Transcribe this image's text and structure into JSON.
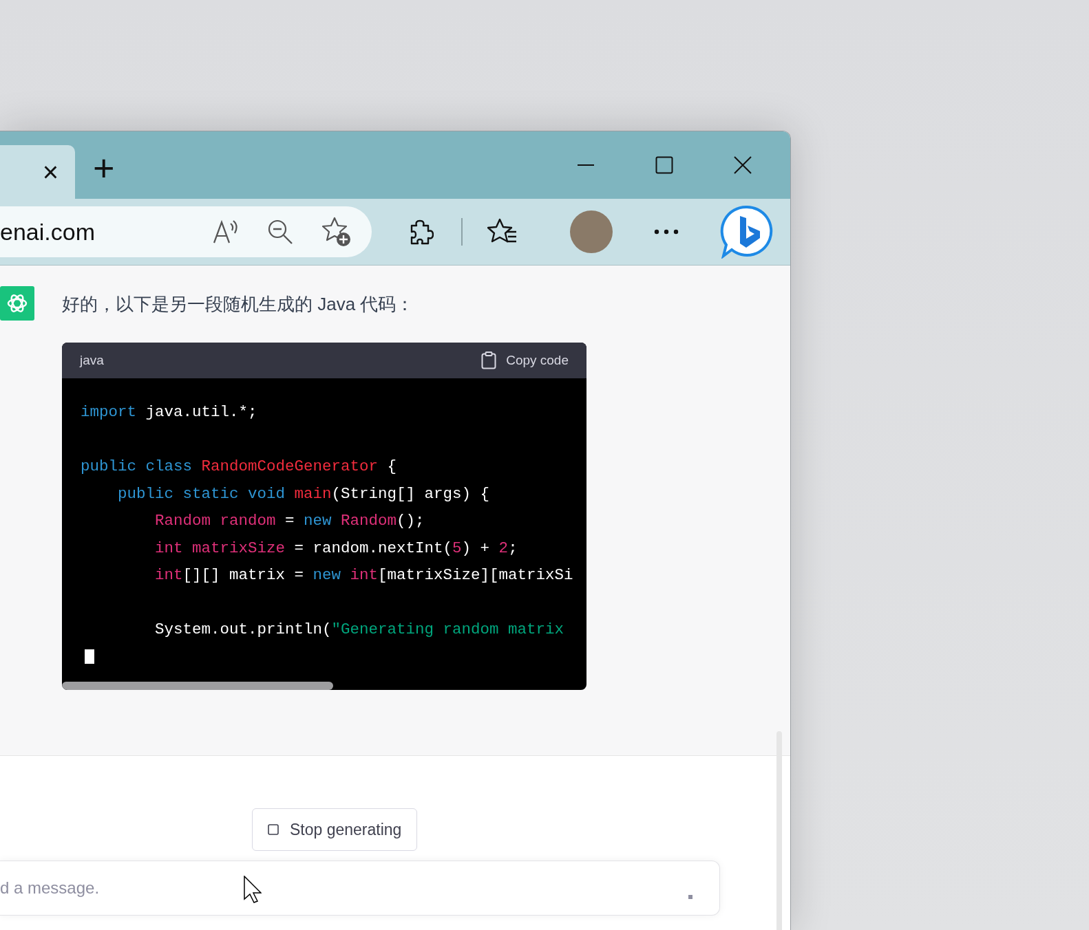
{
  "tab": {
    "close": "×"
  },
  "new_tab": "+",
  "address_bar": {
    "url": "enai.com"
  },
  "message": {
    "text": "好的，以下是另一段随机生成的 Java 代码：",
    "code_block": {
      "language": "java",
      "copy_label": "Copy code",
      "streaming": true,
      "lines": [
        {
          "kind": "code",
          "tokens": [
            {
              "kind": "kw",
              "t": "import"
            },
            {
              "kind": "plain",
              "t": " java.util.*;"
            }
          ]
        },
        {
          "kind": "blank"
        },
        {
          "kind": "code",
          "tokens": [
            {
              "kind": "kw",
              "t": "public class "
            },
            {
              "kind": "title",
              "t": "RandomCodeGenerator"
            },
            {
              "kind": "plain",
              "t": " {"
            }
          ],
          "children": [
            {
              "kind": "code",
              "tokens": [
                {
                  "kind": "kw",
                  "t": "public static void "
                },
                {
                  "kind": "title",
                  "t": "main"
                },
                {
                  "kind": "plain",
                  "t": "(String[] args) {"
                }
              ],
              "children": [
                {
                  "kind": "code",
                  "tokens": [
                    {
                      "kind": "type",
                      "t": "Random random"
                    },
                    {
                      "kind": "plain",
                      "t": " = "
                    },
                    {
                      "kind": "kw",
                      "t": "new "
                    },
                    {
                      "kind": "type",
                      "t": "Random"
                    },
                    {
                      "kind": "plain",
                      "t": "();"
                    }
                  ]
                },
                {
                  "kind": "code",
                  "tokens": [
                    {
                      "kind": "type",
                      "t": "int matrixSize"
                    },
                    {
                      "kind": "plain",
                      "t": " = random.nextInt("
                    },
                    {
                      "kind": "num",
                      "t": "5"
                    },
                    {
                      "kind": "plain",
                      "t": ") + "
                    },
                    {
                      "kind": "num",
                      "t": "2"
                    },
                    {
                      "kind": "plain",
                      "t": ";"
                    }
                  ]
                },
                {
                  "kind": "code",
                  "tokens": [
                    {
                      "kind": "type",
                      "t": "int"
                    },
                    {
                      "kind": "plain",
                      "t": "[][] matrix = "
                    },
                    {
                      "kind": "kw",
                      "t": "new "
                    },
                    {
                      "kind": "type",
                      "t": "int"
                    },
                    {
                      "kind": "plain",
                      "t": "[matrixSize][matrixSi"
                    }
                  ]
                },
                {
                  "kind": "blank"
                },
                {
                  "kind": "code",
                  "tokens": [
                    {
                      "kind": "plain",
                      "t": "System.out.println("
                    },
                    {
                      "kind": "str",
                      "t": "\"Generating random matrix"
                    }
                  ]
                }
              ]
            }
          ]
        }
      ]
    }
  },
  "stop_button": "Stop generating",
  "composer": {
    "placeholder": "d a message."
  }
}
